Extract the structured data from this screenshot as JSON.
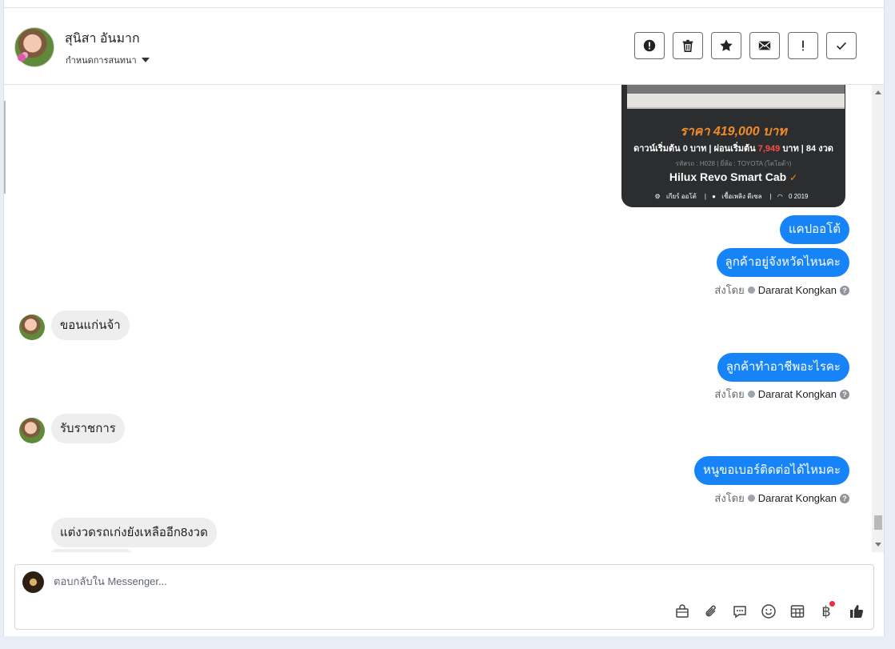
{
  "header": {
    "contact_name": "สุนิสา อันมาก",
    "assign_label": "กำหนดการสนทนา",
    "toolbar": [
      {
        "name": "alert-circle-icon"
      },
      {
        "name": "trash-icon"
      },
      {
        "name": "star-icon"
      },
      {
        "name": "envelope-icon"
      },
      {
        "name": "exclamation-icon"
      },
      {
        "name": "check-icon"
      }
    ]
  },
  "card": {
    "price": "ราคา 419,000 บาท",
    "terms_prefix": "ดาวน์เริ่มต้น 0 บาท | ผ่อนเริ่มต้น",
    "terms_highlight": "7,949",
    "terms_suffix": "บาท | 84 งวด",
    "meta": "รหัสรถ : H028 | ยี่ห้อ : TOYOTA (โตโยต้า)",
    "model": "Hilux Revo Smart Cab",
    "spec_gear": "เกียร์ ออโต้",
    "spec_fuel": "เชื้อเพลิง ดีเซล",
    "spec_year": "0 2019"
  },
  "messages": [
    {
      "dir": "out",
      "text": "แคปออโต้"
    },
    {
      "dir": "out",
      "text": "ลูกค้าอยู่จังหวัดไหนคะ"
    },
    {
      "dir": "in",
      "text": "ขอนแก่นจ้า"
    },
    {
      "dir": "out",
      "text": "ลูกค้าทำอาชีพอะไรคะ"
    },
    {
      "dir": "in",
      "text": "รับราชการ"
    },
    {
      "dir": "out",
      "text": "หนูขอเบอร์ติดต่อได้ไหมคะ"
    },
    {
      "dir": "in",
      "text": "แต่งวดรถเก่งยังเหลืออีก8งวด"
    }
  ],
  "sent_by": {
    "label": "ส่งโดย",
    "agent": "Dararat Kongkan",
    "help": "?"
  },
  "composer": {
    "placeholder": "ตอบกลับใน Messenger...",
    "icons": [
      "bag-icon",
      "paperclip-icon",
      "speech-bubble-icon",
      "smiley-icon",
      "table-icon",
      "baht-icon",
      "thumbs-up-icon"
    ],
    "baht_symbol": "฿",
    "accent_color": "#1684f7",
    "badge_color": "#f02849"
  }
}
